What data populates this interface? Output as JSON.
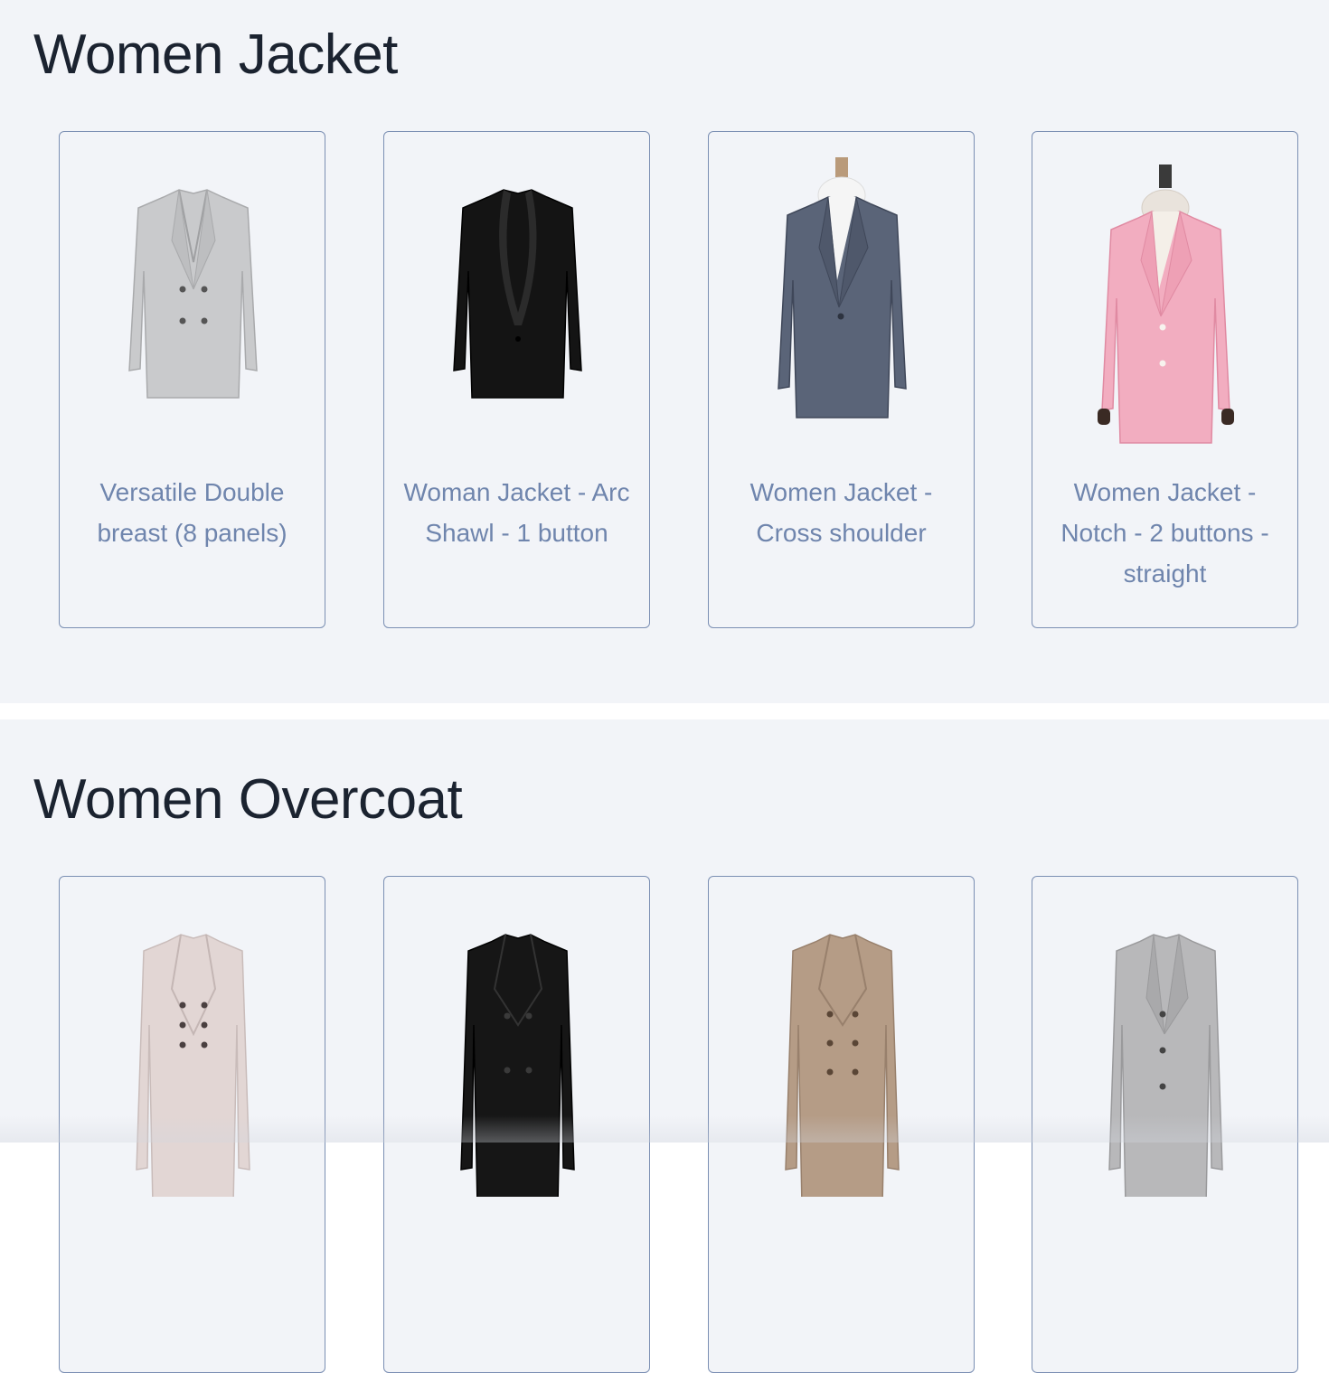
{
  "sections": [
    {
      "title": "Women Jacket",
      "items": [
        {
          "name": "Versatile Double breast (8 panels)",
          "image": "grey-double-breasted-jacket",
          "color": "#c9cacc"
        },
        {
          "name": "Woman Jacket - Arc Shawl - 1 button",
          "image": "black-shawl-collar-jacket",
          "color": "#141414"
        },
        {
          "name": "Women Jacket - Cross shoulder",
          "image": "navy-jacket-on-mannequin",
          "color": "#5a6478"
        },
        {
          "name": "Women Jacket - Notch - 2 buttons - straight",
          "image": "pink-jacket-on-mannequin",
          "color": "#f2adc0"
        }
      ]
    },
    {
      "title": "Women Overcoat",
      "items": [
        {
          "image": "pale-pink-double-breasted-overcoat",
          "color": "#e2d6d4"
        },
        {
          "image": "black-double-breasted-overcoat",
          "color": "#161616"
        },
        {
          "image": "brown-tweed-double-breasted-overcoat",
          "color": "#b59c86"
        },
        {
          "image": "grey-single-breasted-overcoat",
          "color": "#b8b8ba"
        }
      ]
    }
  ]
}
